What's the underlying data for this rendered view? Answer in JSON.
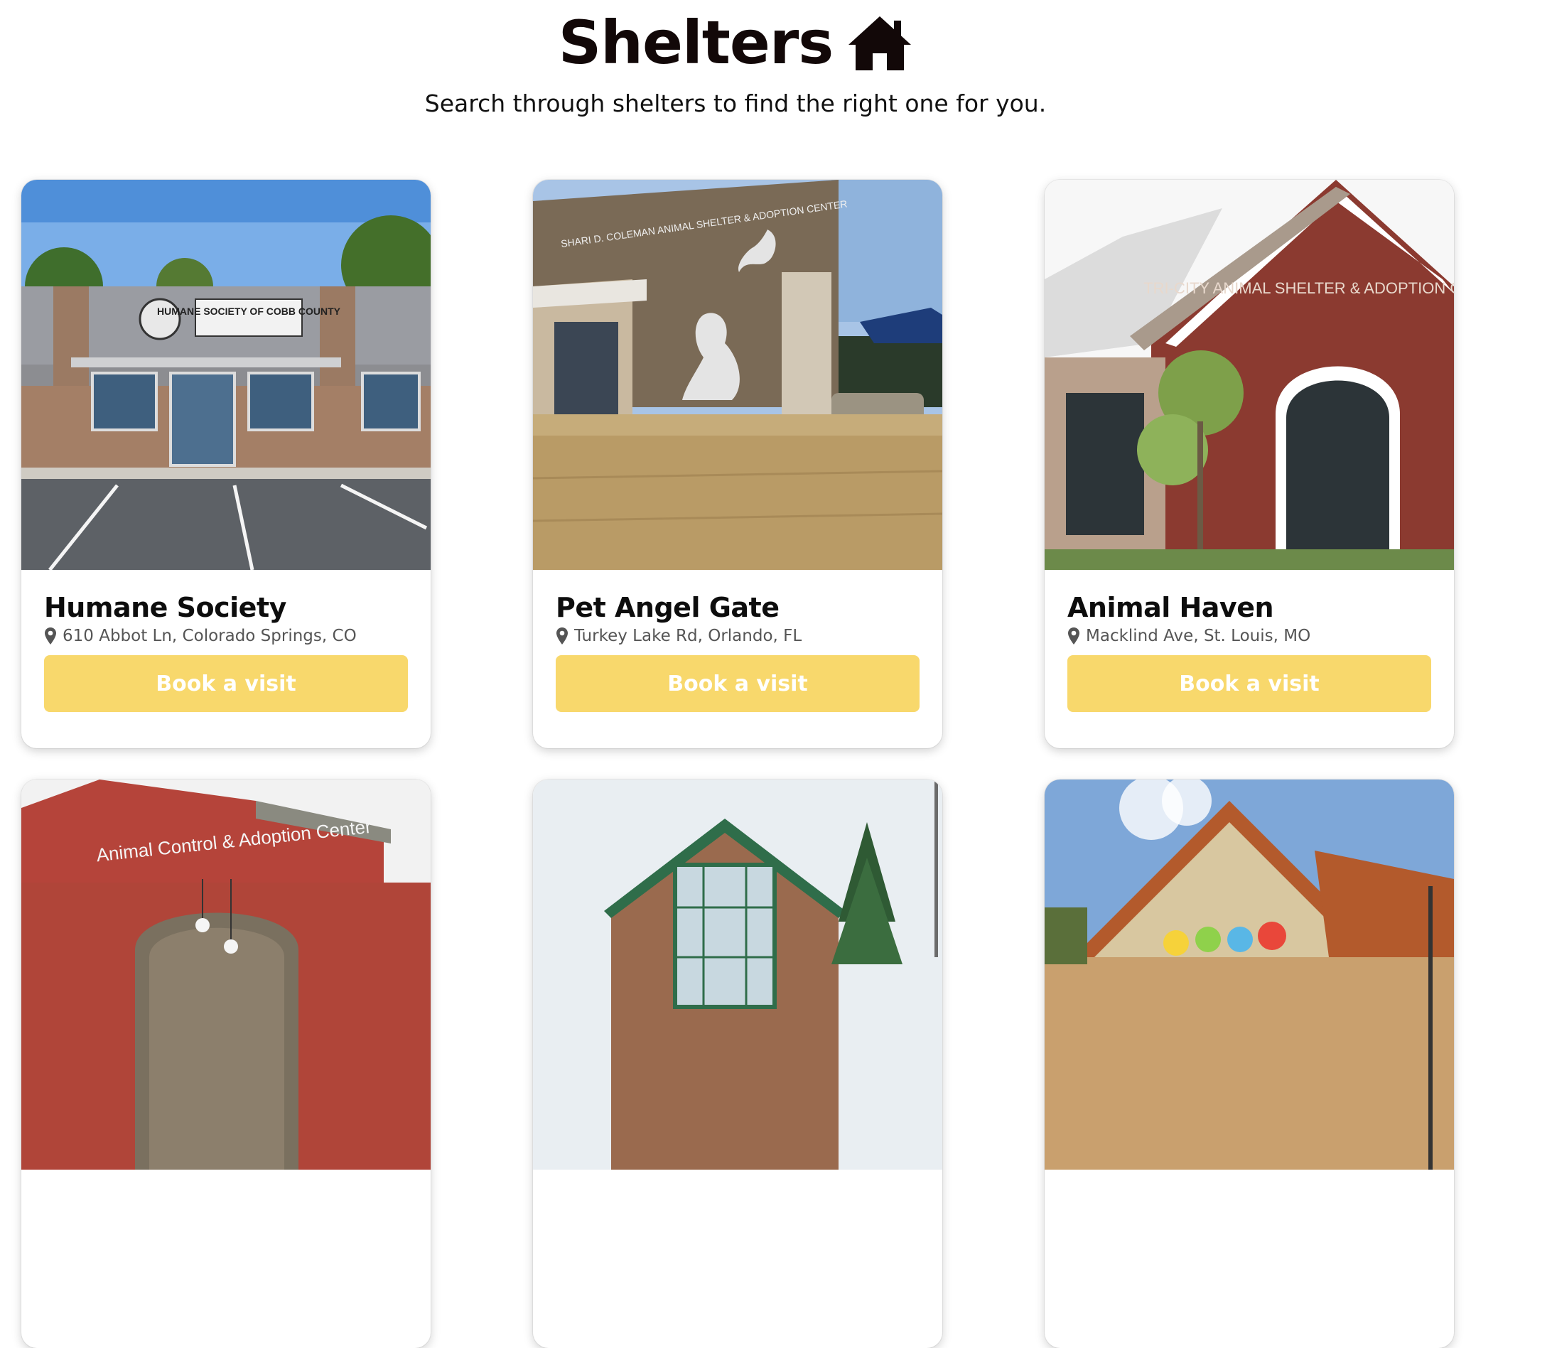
{
  "page": {
    "title": "Shelters",
    "subtitle": "Search through shelters to find the right one for you.",
    "title_icon": "house-icon"
  },
  "colors": {
    "accent_button": "#f8d86c",
    "title_text": "#120808"
  },
  "shelters": [
    {
      "name": "Humane Society",
      "address": "610 Abbot Ln, Colorado Springs, CO",
      "cta": "Book a visit",
      "sign": "HUMANE SOCIETY OF COBB COUNTY"
    },
    {
      "name": "Pet Angel Gate",
      "address": "Turkey Lake Rd, Orlando, FL",
      "cta": "Book a visit",
      "sign": "SHARI D. COLEMAN ANIMAL SHELTER & ADOPTION CENTER"
    },
    {
      "name": "Animal Haven",
      "address": "Macklind Ave, St. Louis, MO",
      "cta": "Book a visit",
      "sign": "TRI-CITY ANIMAL SHELTER & ADOPTION CENTER"
    },
    {
      "sign": "Animal Control & Adoption Center"
    },
    {},
    {}
  ]
}
